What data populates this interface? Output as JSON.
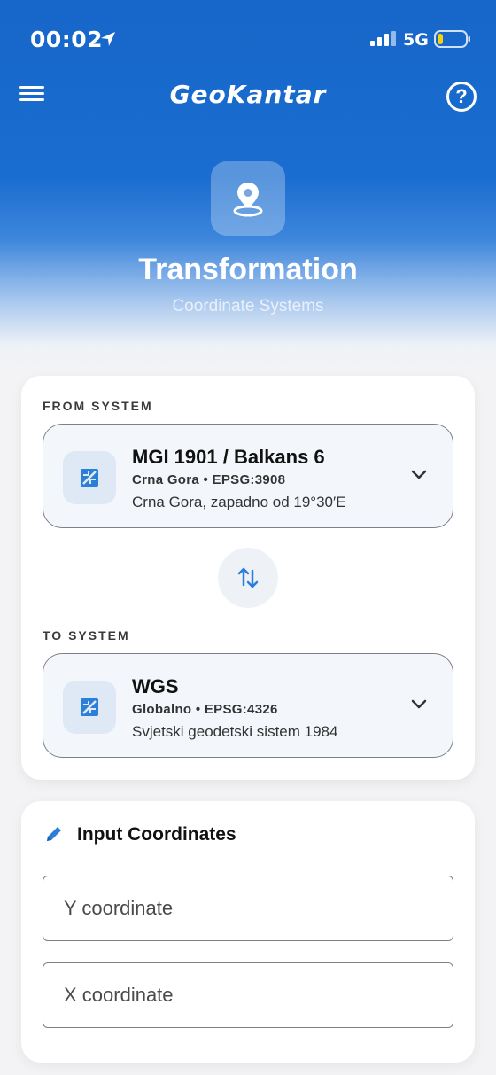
{
  "status_bar": {
    "time": "00:02",
    "network": "5G",
    "battery_level": 0.2,
    "colors": {
      "battery_fill": "#f5d20a"
    }
  },
  "app_bar": {
    "title": "GeoKantar",
    "help_label": "?"
  },
  "hero": {
    "icon": "location-pin-icon",
    "title": "Transformation",
    "subtitle": "Coordinate Systems"
  },
  "systems": {
    "from_label": "FROM SYSTEM",
    "from": {
      "name": "MGI 1901 / Balkans 6",
      "meta": "Crna Gora • EPSG:3908",
      "description": "Crna Gora, zapadno od 19°30′E"
    },
    "to_label": "TO SYSTEM",
    "to": {
      "name": "WGS",
      "meta": "Globalno • EPSG:4326",
      "description": "Svjetski geodetski sistem 1984"
    }
  },
  "input": {
    "title": "Input Coordinates",
    "y_placeholder": "Y coordinate",
    "x_placeholder": "X coordinate"
  },
  "colors": {
    "primary": "#1a6dd0",
    "accent_icon": "#2b7fd9",
    "card_bg": "#ffffff",
    "page_bg": "#f3f3f5"
  }
}
